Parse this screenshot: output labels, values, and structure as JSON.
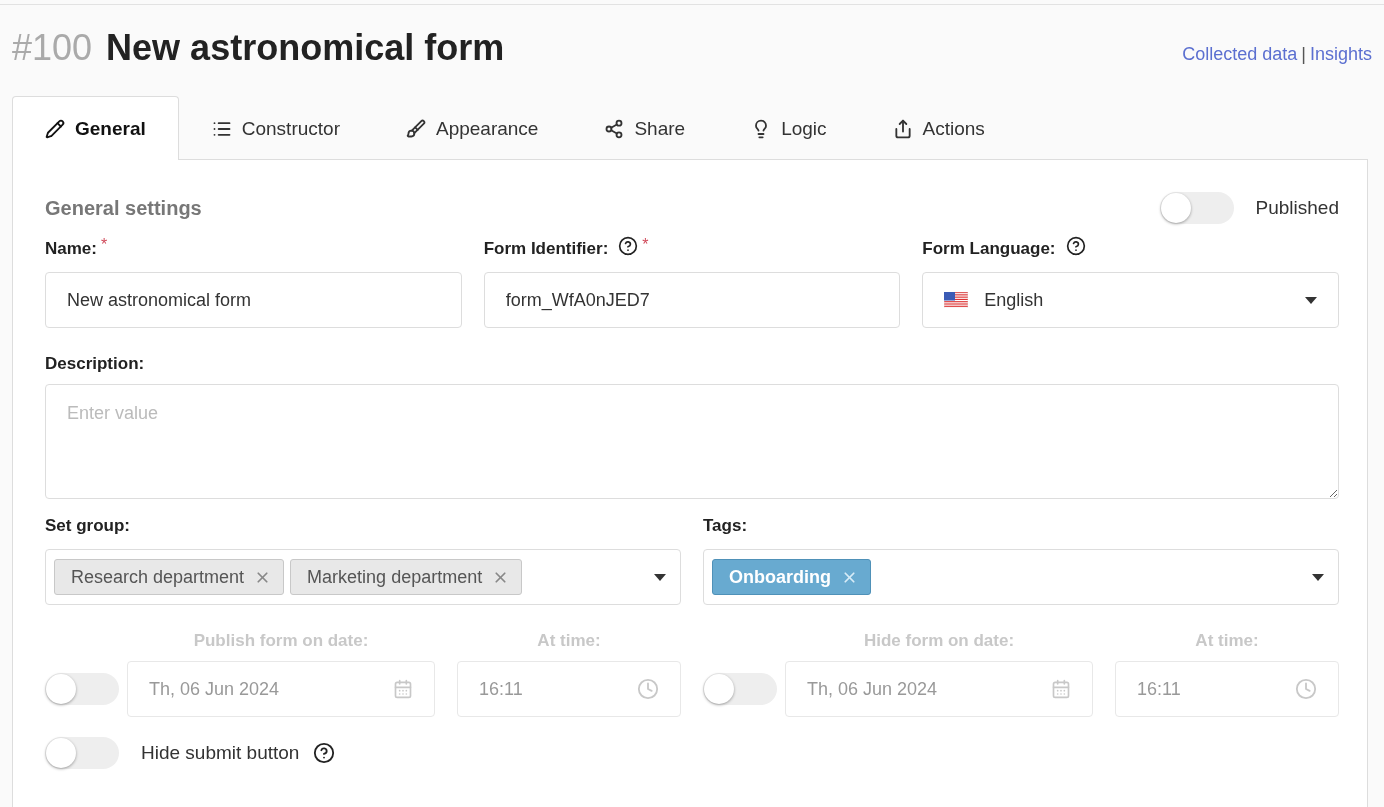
{
  "header": {
    "number": "#100",
    "title": "New astronomical form",
    "links": [
      {
        "label": "Collected data"
      },
      {
        "label": "Insights"
      }
    ],
    "separator": "|"
  },
  "tabs": [
    {
      "label": "General",
      "selected": true
    },
    {
      "label": "Constructor",
      "selected": false
    },
    {
      "label": "Appearance",
      "selected": false
    },
    {
      "label": "Share",
      "selected": false
    },
    {
      "label": "Logic",
      "selected": false
    },
    {
      "label": "Actions",
      "selected": false
    }
  ],
  "section": {
    "title": "General settings",
    "published": {
      "label": "Published",
      "on": false
    }
  },
  "top_fields": [
    {
      "label": "Name:",
      "required_mark": "*",
      "help": false,
      "kind": "text",
      "value": "New astronomical form"
    },
    {
      "label": "Form Identifier:",
      "required_mark": "*",
      "help": true,
      "kind": "text",
      "value": "form_WfA0nJED7"
    },
    {
      "label": "Form Language:",
      "help": true,
      "kind": "select",
      "value": "English"
    }
  ],
  "description": {
    "label": "Description:",
    "placeholder": "Enter value"
  },
  "selects": [
    {
      "label": "Set group:",
      "chips": [
        {
          "label": "Research department",
          "kind": "plain"
        },
        {
          "label": "Marketing department",
          "kind": "plain"
        }
      ]
    },
    {
      "label": "Tags:",
      "chips": [
        {
          "label": "Onboarding",
          "kind": "tag"
        }
      ]
    }
  ],
  "schedules": [
    {
      "on": false,
      "disabled": true,
      "date_label": "Publish form on date:",
      "date": "Th, 06 Jun 2024",
      "time_label": "At time:",
      "time": "16:11"
    },
    {
      "on": false,
      "disabled": true,
      "date_label": "Hide form on date:",
      "date": "Th, 06 Jun 2024",
      "time_label": "At time:",
      "time": "16:11"
    }
  ],
  "hide_submit": {
    "label": "Hide submit button",
    "on": false
  }
}
